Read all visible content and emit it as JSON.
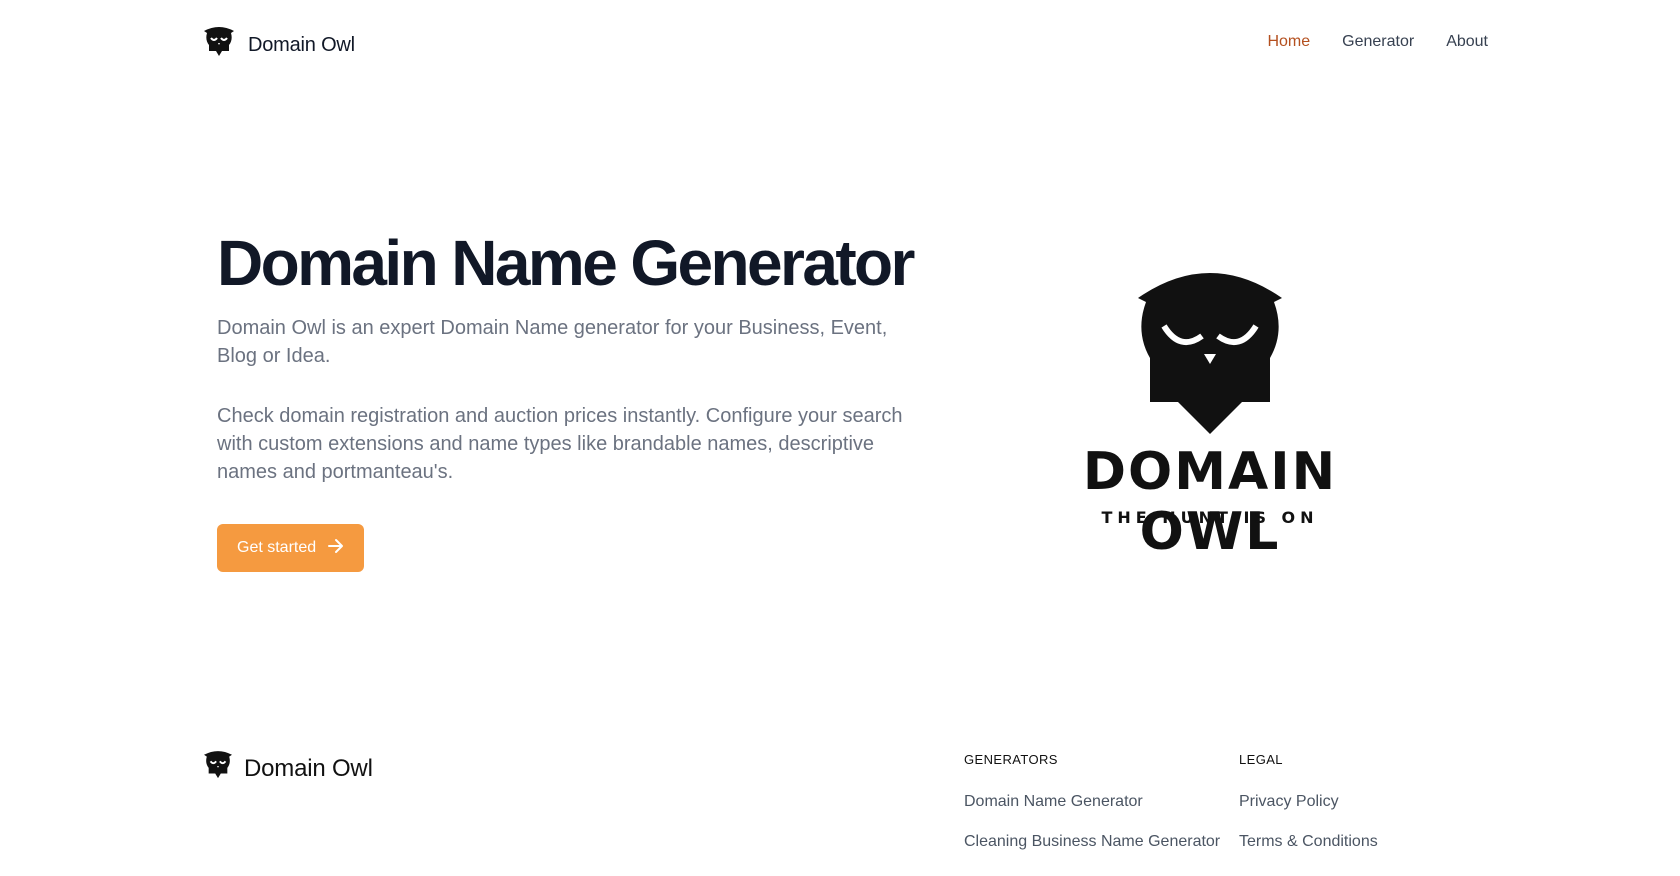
{
  "header": {
    "brand_name": "Domain Owl",
    "nav": [
      {
        "label": "Home",
        "active": true
      },
      {
        "label": "Generator",
        "active": false
      },
      {
        "label": "About",
        "active": false
      }
    ]
  },
  "hero": {
    "title": "Domain Name Generator",
    "paragraph1": "Domain Owl is an expert Domain Name generator for your Business, Event, Blog or Idea.",
    "paragraph2": "Check domain registration and auction prices instantly. Configure your search with custom extensions and name types like brandable names, descriptive names and portmanteau's.",
    "cta_label": "Get started",
    "logo_word": "DOMAIN OWL",
    "logo_tagline": "THE HUNT IS ON"
  },
  "footer": {
    "brand_name": "Domain Owl",
    "columns": [
      {
        "heading": "GENERATORS",
        "links": [
          "Domain Name Generator",
          "Cleaning Business Name Generator"
        ]
      },
      {
        "heading": "LEGAL",
        "links": [
          "Privacy Policy",
          "Terms & Conditions"
        ]
      }
    ]
  },
  "colors": {
    "accent": "#f59a40",
    "nav_active": "#b4501f",
    "heading": "#111827",
    "body_text": "#6b7280"
  },
  "icons": [
    "owl-logo-icon",
    "arrow-right-icon"
  ]
}
